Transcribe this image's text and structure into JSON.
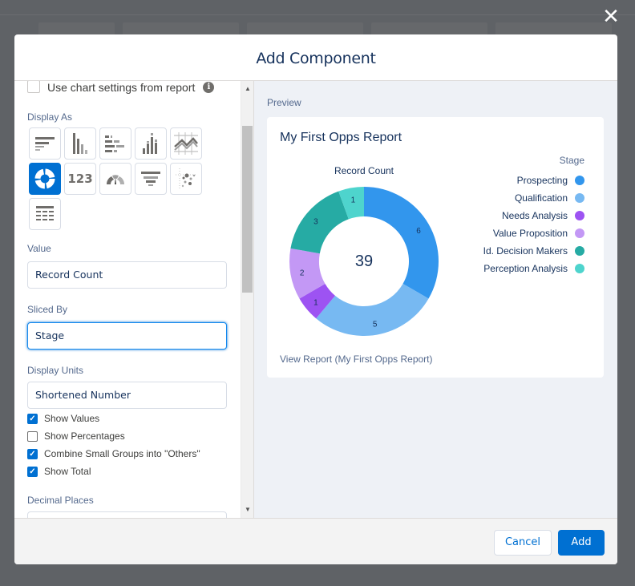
{
  "window": {
    "close_icon": "close-icon"
  },
  "modal": {
    "title": "Add Component",
    "left_panel": {
      "use_chart_settings": {
        "label": "Use chart settings from report",
        "checked": false
      },
      "display_as": {
        "label": "Display As",
        "types": [
          {
            "name": "horizontal-bar",
            "selected": false
          },
          {
            "name": "vertical-bar",
            "selected": false
          },
          {
            "name": "stacked-horizontal-bar",
            "selected": false
          },
          {
            "name": "stacked-vertical-bar",
            "selected": false
          },
          {
            "name": "line",
            "selected": false
          },
          {
            "name": "donut",
            "selected": true
          },
          {
            "name": "metric",
            "selected": false,
            "text": "123"
          },
          {
            "name": "gauge",
            "selected": false
          },
          {
            "name": "funnel",
            "selected": false
          },
          {
            "name": "scatter",
            "selected": false
          },
          {
            "name": "table",
            "selected": false
          }
        ]
      },
      "value": {
        "label": "Value",
        "current": "Record Count"
      },
      "sliced_by": {
        "label": "Sliced By",
        "current": "Stage"
      },
      "display_units": {
        "label": "Display Units",
        "current": "Shortened Number"
      },
      "checkboxes": [
        {
          "label": "Show Values",
          "checked": true
        },
        {
          "label": "Show Percentages",
          "checked": false
        },
        {
          "label": "Combine Small Groups into \"Others\"",
          "checked": true
        },
        {
          "label": "Show Total",
          "checked": true
        }
      ],
      "decimal_places": {
        "label": "Decimal Places"
      }
    },
    "preview": {
      "label": "Preview",
      "card_title": "My First Opps Report",
      "view_report_link": "View Report (My First Opps Report)"
    },
    "footer": {
      "cancel_label": "Cancel",
      "add_label": "Add"
    }
  },
  "chart_data": {
    "type": "pie",
    "variant": "donut",
    "title": "Record Count",
    "legend_title": "Stage",
    "legend_position": "right",
    "center_total": "39",
    "categories": [
      "Prospecting",
      "Qualification",
      "Needs Analysis",
      "Value Proposition",
      "Id. Decision Makers",
      "Perception Analysis"
    ],
    "values": [
      6,
      5,
      1,
      2,
      3,
      1
    ],
    "colors": [
      "#3296ed",
      "#77b9f2",
      "#9d53f2",
      "#c398f5",
      "#26aba4",
      "#4ed4cd"
    ]
  }
}
